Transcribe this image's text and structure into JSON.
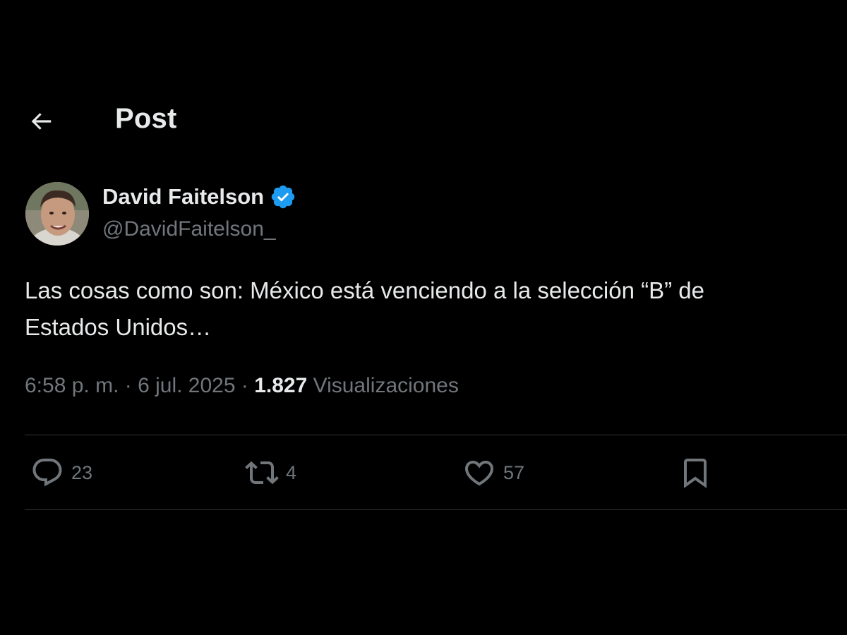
{
  "header": {
    "title": "Post",
    "back_icon": "back-arrow-icon"
  },
  "author": {
    "display_name": "David Faitelson",
    "handle": "@DavidFaitelson_",
    "verified_icon": "verified-badge-icon",
    "verified_color": "#1d9bf0"
  },
  "post": {
    "line1": "Las cosas como son: México está venciendo a la selección “B” de",
    "line2": "Estados Unidos…"
  },
  "meta": {
    "time": "6:58 p. m.",
    "separator1": " · ",
    "date": "6 jul. 2025",
    "separator2": " · ",
    "views_count": "1.827",
    "views_label": " Visualizaciones"
  },
  "actions": {
    "replies": {
      "icon": "reply-icon",
      "count": "23"
    },
    "reposts": {
      "icon": "repost-icon",
      "count": "4"
    },
    "likes": {
      "icon": "like-icon",
      "count": "57"
    },
    "bookmark": {
      "icon": "bookmark-icon"
    }
  },
  "colors": {
    "background": "#000000",
    "primary_text": "#e7e9ea",
    "secondary_text": "#71767b",
    "divider": "#2f3336",
    "accent": "#1d9bf0"
  }
}
